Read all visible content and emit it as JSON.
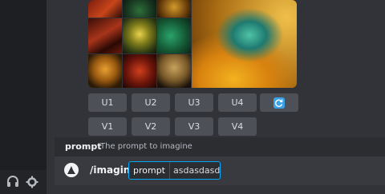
{
  "upscale_buttons": [
    "U1",
    "U2",
    "U3",
    "U4"
  ],
  "variation_buttons": [
    "V1",
    "V2",
    "V3",
    "V4"
  ],
  "reroll": {
    "icon": "refresh-icon"
  },
  "hint": {
    "name": "prompt",
    "description": "The prompt to imagine"
  },
  "command": {
    "name": "/imagine",
    "param_label": "prompt",
    "param_value": "asdasdasd"
  },
  "rail_icons": [
    "headphones-icon",
    "gear-icon"
  ],
  "colors": {
    "background": "#313338",
    "input": "#383a40",
    "accent": "#00a8fc",
    "button": "#4e5058"
  }
}
